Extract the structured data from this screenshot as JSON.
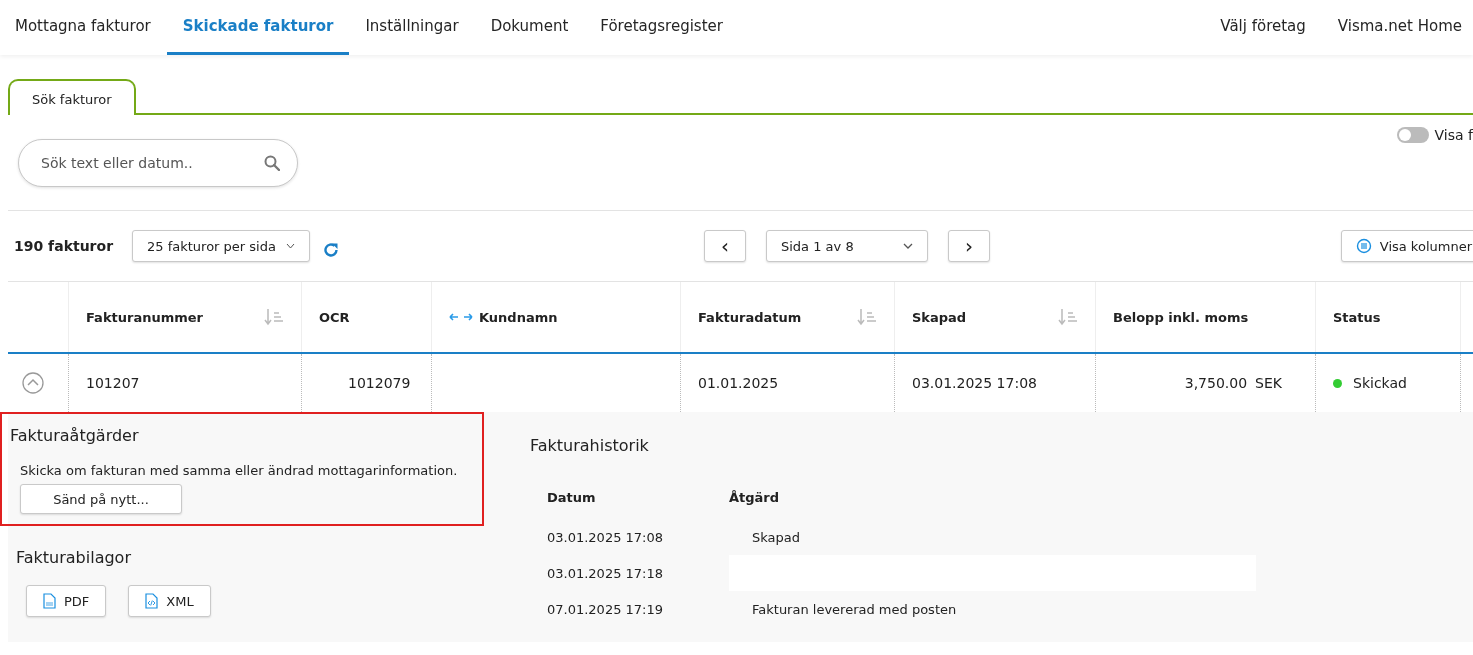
{
  "top_nav": {
    "items": [
      {
        "label": "Mottagna fakturor",
        "selected": false
      },
      {
        "label": "Skickade fakturor",
        "selected": true
      },
      {
        "label": "Inställningar",
        "selected": false
      },
      {
        "label": "Dokument",
        "selected": false
      },
      {
        "label": "Företagsregister",
        "selected": false
      }
    ],
    "right_items": [
      "Välj företag",
      "Visma.net Home"
    ]
  },
  "tabs": [
    {
      "label": "Sök fakturor"
    }
  ],
  "search": {
    "placeholder": "Sök text eller datum.."
  },
  "toggle": {
    "label": "Visa f",
    "on": false
  },
  "toolbar": {
    "count": "190 fakturor",
    "page_size": "25 fakturor per sida",
    "page": "Sida 1 av 8",
    "prev": "‹",
    "next": "›",
    "columns_button": "Visa kolumner"
  },
  "table": {
    "columns": [
      {
        "label": "Fakturanummer",
        "kind": "sortable"
      },
      {
        "label": "OCR",
        "kind": "plain"
      },
      {
        "label": "Kundnamn",
        "kind": "resizable"
      },
      {
        "label": "Fakturadatum",
        "kind": "sortable"
      },
      {
        "label": "Skapad",
        "kind": "sortable"
      },
      {
        "label": "Belopp inkl. moms",
        "kind": "plain"
      },
      {
        "label": "Status",
        "kind": "plain"
      }
    ],
    "rows": [
      {
        "expanded": true,
        "invoice_number": "101207",
        "ocr": "1012079",
        "invoice_date": "01.01.2025",
        "created": "03.01.2025 17:08",
        "amount": "3,750.00",
        "currency": "SEK",
        "status": "Skickad",
        "color": "#33cc33"
      }
    ]
  },
  "details": {
    "actions": {
      "title": "Fakturaåtgärder",
      "text": "Skicka om fakturan med samma eller ändrad mottagarinformation.",
      "button": "Sänd på nytt...",
      "highlighted": true
    },
    "attachments": {
      "title": "Fakturabilagor",
      "files": [
        {
          "label": "PDF",
          "kind": "pdf"
        },
        {
          "label": "XML",
          "kind": "xml"
        }
      ]
    },
    "history": {
      "title": "Fakturahistorik",
      "columns": [
        "Datum",
        "Åtgärd"
      ],
      "rows": [
        {
          "date": "03.01.2025 17:08",
          "action": "Skapad",
          "highlighted": false
        },
        {
          "date": "03.01.2025 17:18",
          "highlighted": true
        },
        {
          "date": "07.01.2025 17:19",
          "action": "Fakturan levererad med posten",
          "highlighted": false
        }
      ]
    }
  }
}
